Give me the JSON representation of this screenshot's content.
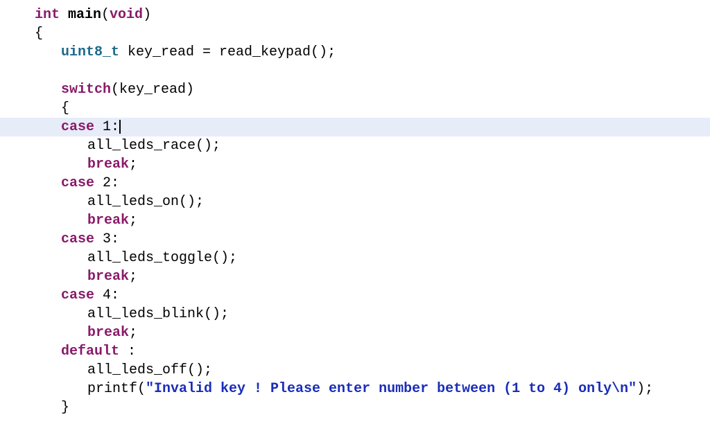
{
  "code": {
    "lines": [
      {
        "cls": "line",
        "tokens": [
          {
            "t": "int ",
            "c": "kw"
          },
          {
            "t": "main",
            "c": "funcname"
          },
          {
            "t": "(",
            "c": "op"
          },
          {
            "t": "void",
            "c": "kw"
          },
          {
            "t": ")",
            "c": "op"
          }
        ]
      },
      {
        "cls": "line",
        "tokens": [
          {
            "t": "{",
            "c": "op"
          }
        ]
      },
      {
        "cls": "line indent1",
        "tokens": [
          {
            "t": "uint8_t",
            "c": "type"
          },
          {
            "t": " key_read = read_keypad();",
            "c": "id"
          }
        ]
      },
      {
        "cls": "line",
        "tokens": [
          {
            "t": "",
            "c": ""
          }
        ]
      },
      {
        "cls": "line indent1",
        "tokens": [
          {
            "t": "switch",
            "c": "kw"
          },
          {
            "t": "(key_read)",
            "c": "id"
          }
        ]
      },
      {
        "cls": "line indent1",
        "tokens": [
          {
            "t": "{",
            "c": "op"
          }
        ]
      },
      {
        "cls": "line indent1 highlight",
        "tokens": [
          {
            "t": "case",
            "c": "kw"
          },
          {
            "t": " 1:",
            "c": "id"
          },
          {
            "t": "CURSOR",
            "c": "cursor"
          }
        ]
      },
      {
        "cls": "line indent2",
        "tokens": [
          {
            "t": "all_leds_race();",
            "c": "id"
          }
        ]
      },
      {
        "cls": "line indent2",
        "tokens": [
          {
            "t": "break",
            "c": "kw"
          },
          {
            "t": ";",
            "c": "op"
          }
        ]
      },
      {
        "cls": "line indent1",
        "tokens": [
          {
            "t": "case",
            "c": "kw"
          },
          {
            "t": " 2:",
            "c": "id"
          }
        ]
      },
      {
        "cls": "line indent2",
        "tokens": [
          {
            "t": "all_leds_on();",
            "c": "id"
          }
        ]
      },
      {
        "cls": "line indent2",
        "tokens": [
          {
            "t": "break",
            "c": "kw"
          },
          {
            "t": ";",
            "c": "op"
          }
        ]
      },
      {
        "cls": "line indent1",
        "tokens": [
          {
            "t": "case",
            "c": "kw"
          },
          {
            "t": " 3:",
            "c": "id"
          }
        ]
      },
      {
        "cls": "line indent2",
        "tokens": [
          {
            "t": "all_leds_toggle();",
            "c": "id"
          }
        ]
      },
      {
        "cls": "line indent2",
        "tokens": [
          {
            "t": "break",
            "c": "kw"
          },
          {
            "t": ";",
            "c": "op"
          }
        ]
      },
      {
        "cls": "line indent1",
        "tokens": [
          {
            "t": "case",
            "c": "kw"
          },
          {
            "t": " 4:",
            "c": "id"
          }
        ]
      },
      {
        "cls": "line indent2",
        "tokens": [
          {
            "t": "all_leds_blink();",
            "c": "id"
          }
        ]
      },
      {
        "cls": "line indent2",
        "tokens": [
          {
            "t": "break",
            "c": "kw"
          },
          {
            "t": ";",
            "c": "op"
          }
        ]
      },
      {
        "cls": "line indent1",
        "tokens": [
          {
            "t": "default",
            "c": "kw"
          },
          {
            "t": " :",
            "c": "op"
          }
        ]
      },
      {
        "cls": "line indent2",
        "tokens": [
          {
            "t": "all_leds_off();",
            "c": "id"
          }
        ]
      },
      {
        "cls": "line indent2",
        "tokens": [
          {
            "t": "printf(",
            "c": "id"
          },
          {
            "t": "\"Invalid key ! Please enter number between (1 to 4) only\\n\"",
            "c": "str"
          },
          {
            "t": ");",
            "c": "id"
          }
        ]
      },
      {
        "cls": "line indent1",
        "tokens": [
          {
            "t": "}",
            "c": "op"
          }
        ]
      }
    ]
  }
}
